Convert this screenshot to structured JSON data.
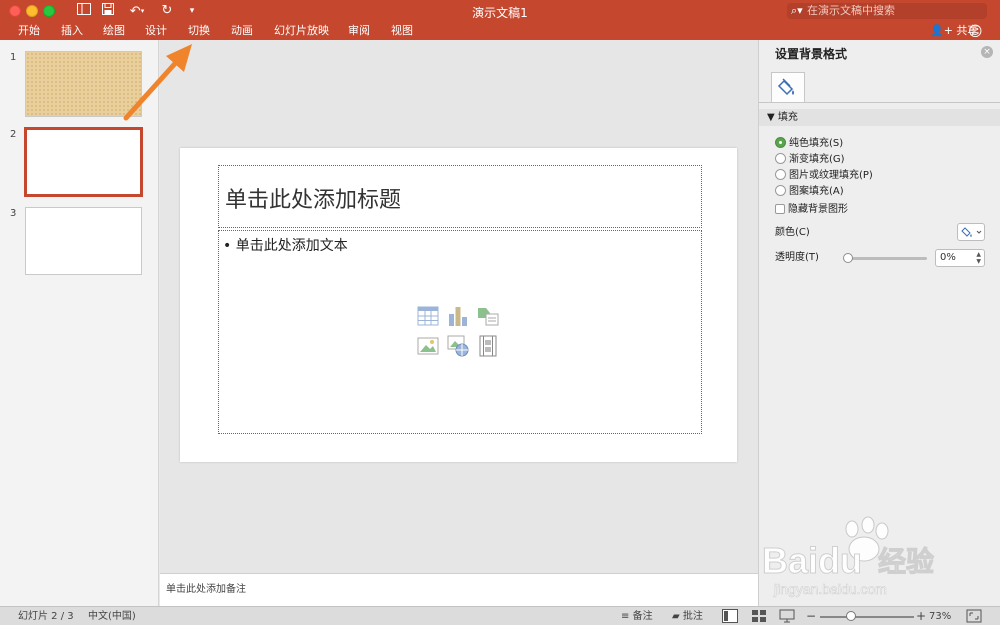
{
  "window": {
    "title": "演示文稿1",
    "search_placeholder": "在演示文稿中搜索"
  },
  "ribbon": {
    "tabs": [
      {
        "label": "开始"
      },
      {
        "label": "插入"
      },
      {
        "label": "绘图"
      },
      {
        "label": "设计"
      },
      {
        "label": "切换"
      },
      {
        "label": "动画"
      },
      {
        "label": "幻灯片放映"
      },
      {
        "label": "审阅"
      },
      {
        "label": "视图"
      }
    ],
    "share_label": "共享"
  },
  "thumbnails": [
    {
      "number": "1",
      "style": "textured"
    },
    {
      "number": "2",
      "style": "blank",
      "selected": true
    },
    {
      "number": "3",
      "style": "blank"
    }
  ],
  "slide": {
    "title_placeholder": "单击此处添加标题",
    "body_placeholder": "• 单击此处添加文本",
    "insert_icons": [
      "table-icon",
      "chart-icon",
      "smartart-icon",
      "picture-icon",
      "online-picture-icon",
      "video-icon"
    ]
  },
  "notes": {
    "placeholder": "单击此处添加备注"
  },
  "format_pane": {
    "title": "设置背景格式",
    "section": "填充",
    "options": [
      {
        "label": "纯色填充(S)",
        "checked": true
      },
      {
        "label": "渐变填充(G)",
        "checked": false
      },
      {
        "label": "图片或纹理填充(P)",
        "checked": false
      },
      {
        "label": "图案填充(A)",
        "checked": false
      }
    ],
    "hide_background_label": "隐藏背景图形",
    "color_label": "颜色(C)",
    "transparency_label": "透明度(T)",
    "transparency_value": "0%",
    "transparency_level": 0
  },
  "status_bar": {
    "slide_indicator": "幻灯片 2 / 3",
    "language": "中文(中国)",
    "notes_label": "备注",
    "comments_label": "批注",
    "zoom": "73%"
  },
  "colors": {
    "accent": "#c4472e",
    "selected_radio": "#5aa54b",
    "annotation_arrow": "#f0842c"
  },
  "watermark": {
    "brand": "Baidu",
    "brand_cn": "经验",
    "url": "jingyan.baidu.com"
  }
}
